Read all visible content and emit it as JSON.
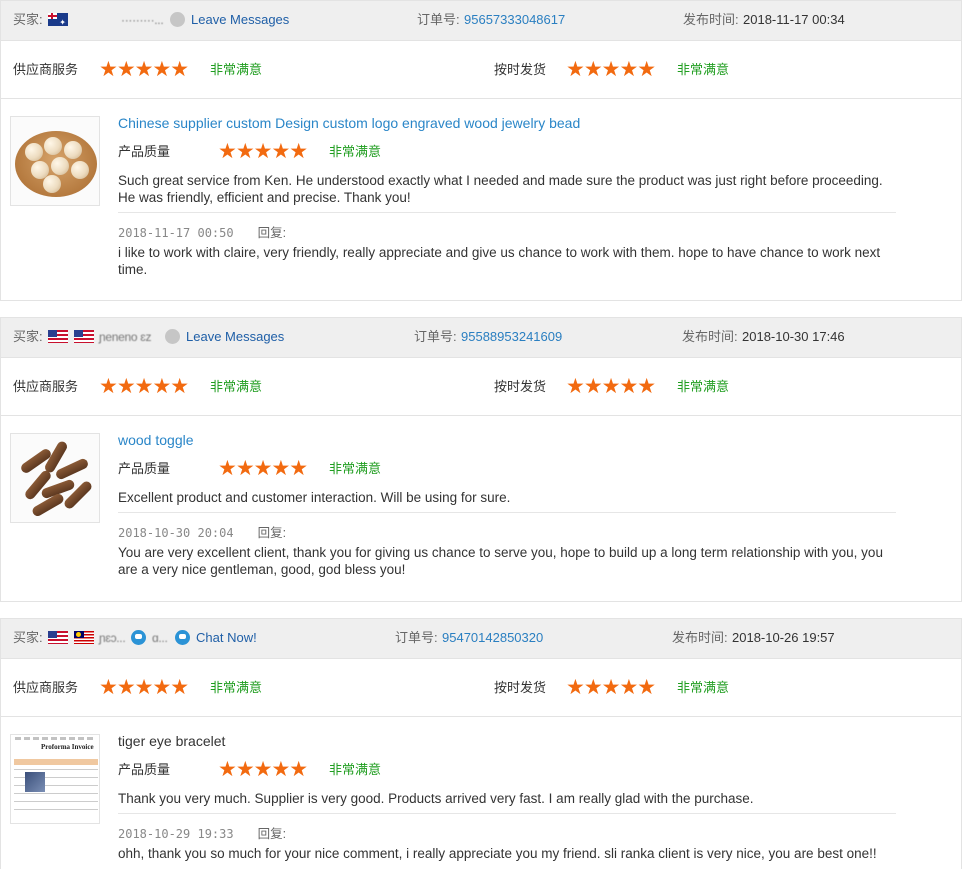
{
  "labels": {
    "buyer": "买家:",
    "order_no": "订单号:",
    "posted_at": "发布时间:",
    "supplier_service": "供应商服务",
    "on_time_delivery": "按时发货",
    "product_quality": "产品质量",
    "reply": "回复:",
    "very_satisfied": "非常满意"
  },
  "stars_glyph": "★★★★★",
  "colors": {
    "star": "#f26a10",
    "satisfied_text": "#1f9d1f",
    "link": "#2a86c8",
    "header_bg": "#efefef"
  },
  "reviews": [
    {
      "flags": [
        "australia-flag"
      ],
      "buyer_name": "·········...",
      "contact_label": "Leave Messages",
      "order_number": "95657333048617",
      "posted": "2018-11-17 00:34",
      "supplier_service_rating": 5,
      "delivery_rating": 5,
      "quality_rating": 5,
      "product_title": "Chinese supplier custom Design custom logo engraved wood jewelry bead",
      "feedback": "Such great service from Ken. He understood exactly what I needed and made sure the product was just right before proceeding. He was friendly, efficient and precise. Thank you!",
      "reply_date": "2018-11-17 00:50",
      "reply_text": "i like to work with claire, very friendly, really appreciate and give us chance to work with them. hope to have chance to work next time."
    },
    {
      "flags": [
        "usa-flag",
        "usa-flag"
      ],
      "buyer_name": "ɲeneno ɛz",
      "contact_label": "Leave Messages",
      "order_number": "95588953241609",
      "posted": "2018-10-30 17:46",
      "supplier_service_rating": 5,
      "delivery_rating": 5,
      "quality_rating": 5,
      "product_title": "wood toggle",
      "feedback": "Excellent product and customer interaction. Will be using for sure.",
      "reply_date": "2018-10-30 20:04",
      "reply_text": "You are very excellent client, thank you for giving us chance to serve you, hope to build up a long term relationship with you, you are a very nice gentleman, good, god bless you!"
    },
    {
      "flags": [
        "usa-flag",
        "malaysia-flag"
      ],
      "buyer_name": "ɲɛɔ...",
      "buyer_name_2": "ɑ...",
      "contact_label": "Chat Now!",
      "order_number": "95470142850320",
      "posted": "2018-10-26 19:57",
      "supplier_service_rating": 5,
      "delivery_rating": 5,
      "quality_rating": 5,
      "product_title": "tiger eye bracelet",
      "thumb_caption": "Proforma Invoice",
      "feedback": "Thank you very much. Supplier is very good. Products arrived very fast. I am really glad with the purchase.",
      "reply_date": "2018-10-29 19:33",
      "reply_text": "ohh, thank you so much for your nice comment, i really appreciate you my friend. sli ranka client is very nice, you are best one!!"
    }
  ]
}
